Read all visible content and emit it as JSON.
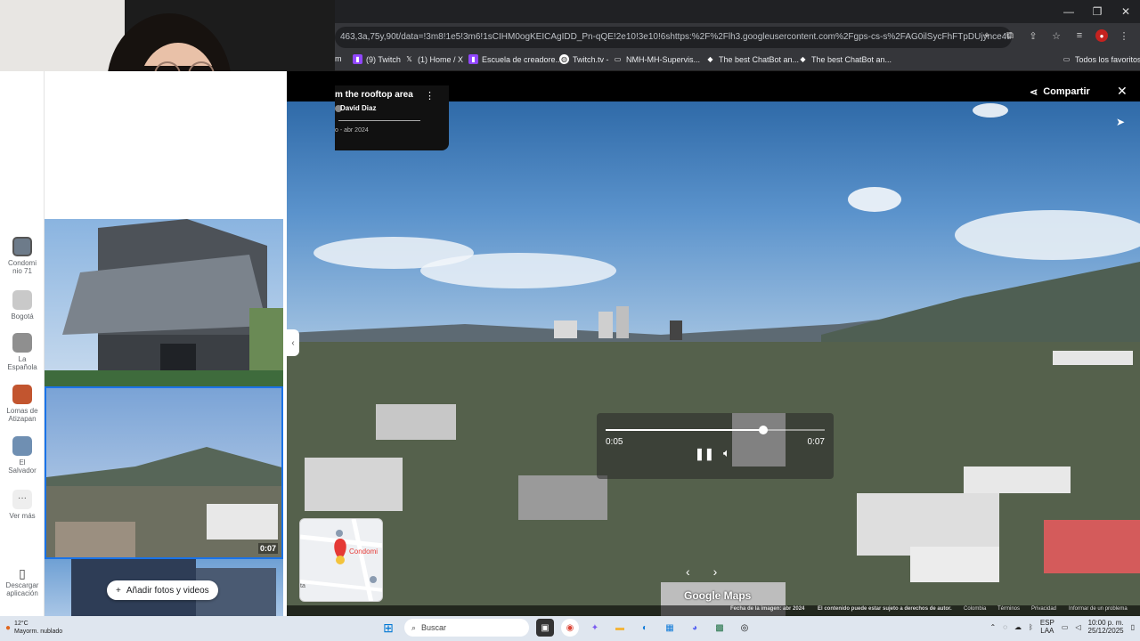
{
  "browser": {
    "url": "463,3a,75y,90t/data=!3m8!1e5!3m6!1sCIHM0ogKEICAgIDD_Pn-qQE!2e10!3e10!6shttps:%2F%2Flh3.googleusercontent.com%2Fgps-cs-s%2FAG0ilSycFhFTpDUjynce4tly0lcngWyuU9OF...",
    "window_controls": [
      "—",
      "❐",
      "✕"
    ],
    "bookmarks": [
      {
        "label": "m",
        "color": "#202124"
      },
      {
        "label": "(9) Twitch",
        "color": "#9146ff"
      },
      {
        "label": "(1) Home / X",
        "color": "#000000"
      },
      {
        "label": "Escuela de creadore...",
        "color": "#9146ff"
      },
      {
        "label": "Twitch.tv -",
        "color": "#ffffff"
      },
      {
        "label": "NMH-MH-Supervis...",
        "color": "#ffffff"
      },
      {
        "label": "The best ChatBot an...",
        "color": "#ffffff"
      },
      {
        "label": "The best ChatBot an...",
        "color": "#ffffff"
      }
    ],
    "all_bookmarks": "Todos los favoritos"
  },
  "rail": {
    "items": [
      {
        "label": "Condomi\nnio 71",
        "color": "#6d7b8a"
      },
      {
        "label": "Bogotá",
        "color": "#c9c9c9"
      },
      {
        "label": "La\nEspañola",
        "color": "#8f8f8f"
      },
      {
        "label": "Lomas de\nAtizapan",
        "color": "#c2552f"
      },
      {
        "label": "El\nSalvador",
        "color": "#6f8fb2"
      },
      {
        "label": "Ver más",
        "color": "#eeeeee"
      }
    ],
    "download_label": "Descargar\naplicación"
  },
  "gallery": {
    "video_duration": "0:07",
    "add_button": "Añadir fotos y videos"
  },
  "viewer": {
    "title": "m the rooftop area",
    "author": "David Diaz",
    "date": "o - abr 2024",
    "share_label": "Compartir",
    "player": {
      "current_time": "0:05",
      "duration": "0:07",
      "progress": 0.72
    },
    "minimap_label": "Condomi",
    "minimap_label2": "ta",
    "logo": "Google Maps",
    "footer": {
      "date": "Fecha de la imagen: abr 2024",
      "copyright": "El contenido puede estar sujeto a derechos de autor.",
      "country": "Colombia",
      "terms": "Términos",
      "privacy": "Privacidad",
      "report": "Informar de un problema"
    }
  },
  "taskbar": {
    "weather_temp": "12°C",
    "weather_desc": "Mayorm. nublado",
    "search_placeholder": "Buscar",
    "lang": "ESP",
    "lang2": "LAA",
    "time": "10:00 p. m.",
    "date": "25/12/2025"
  }
}
